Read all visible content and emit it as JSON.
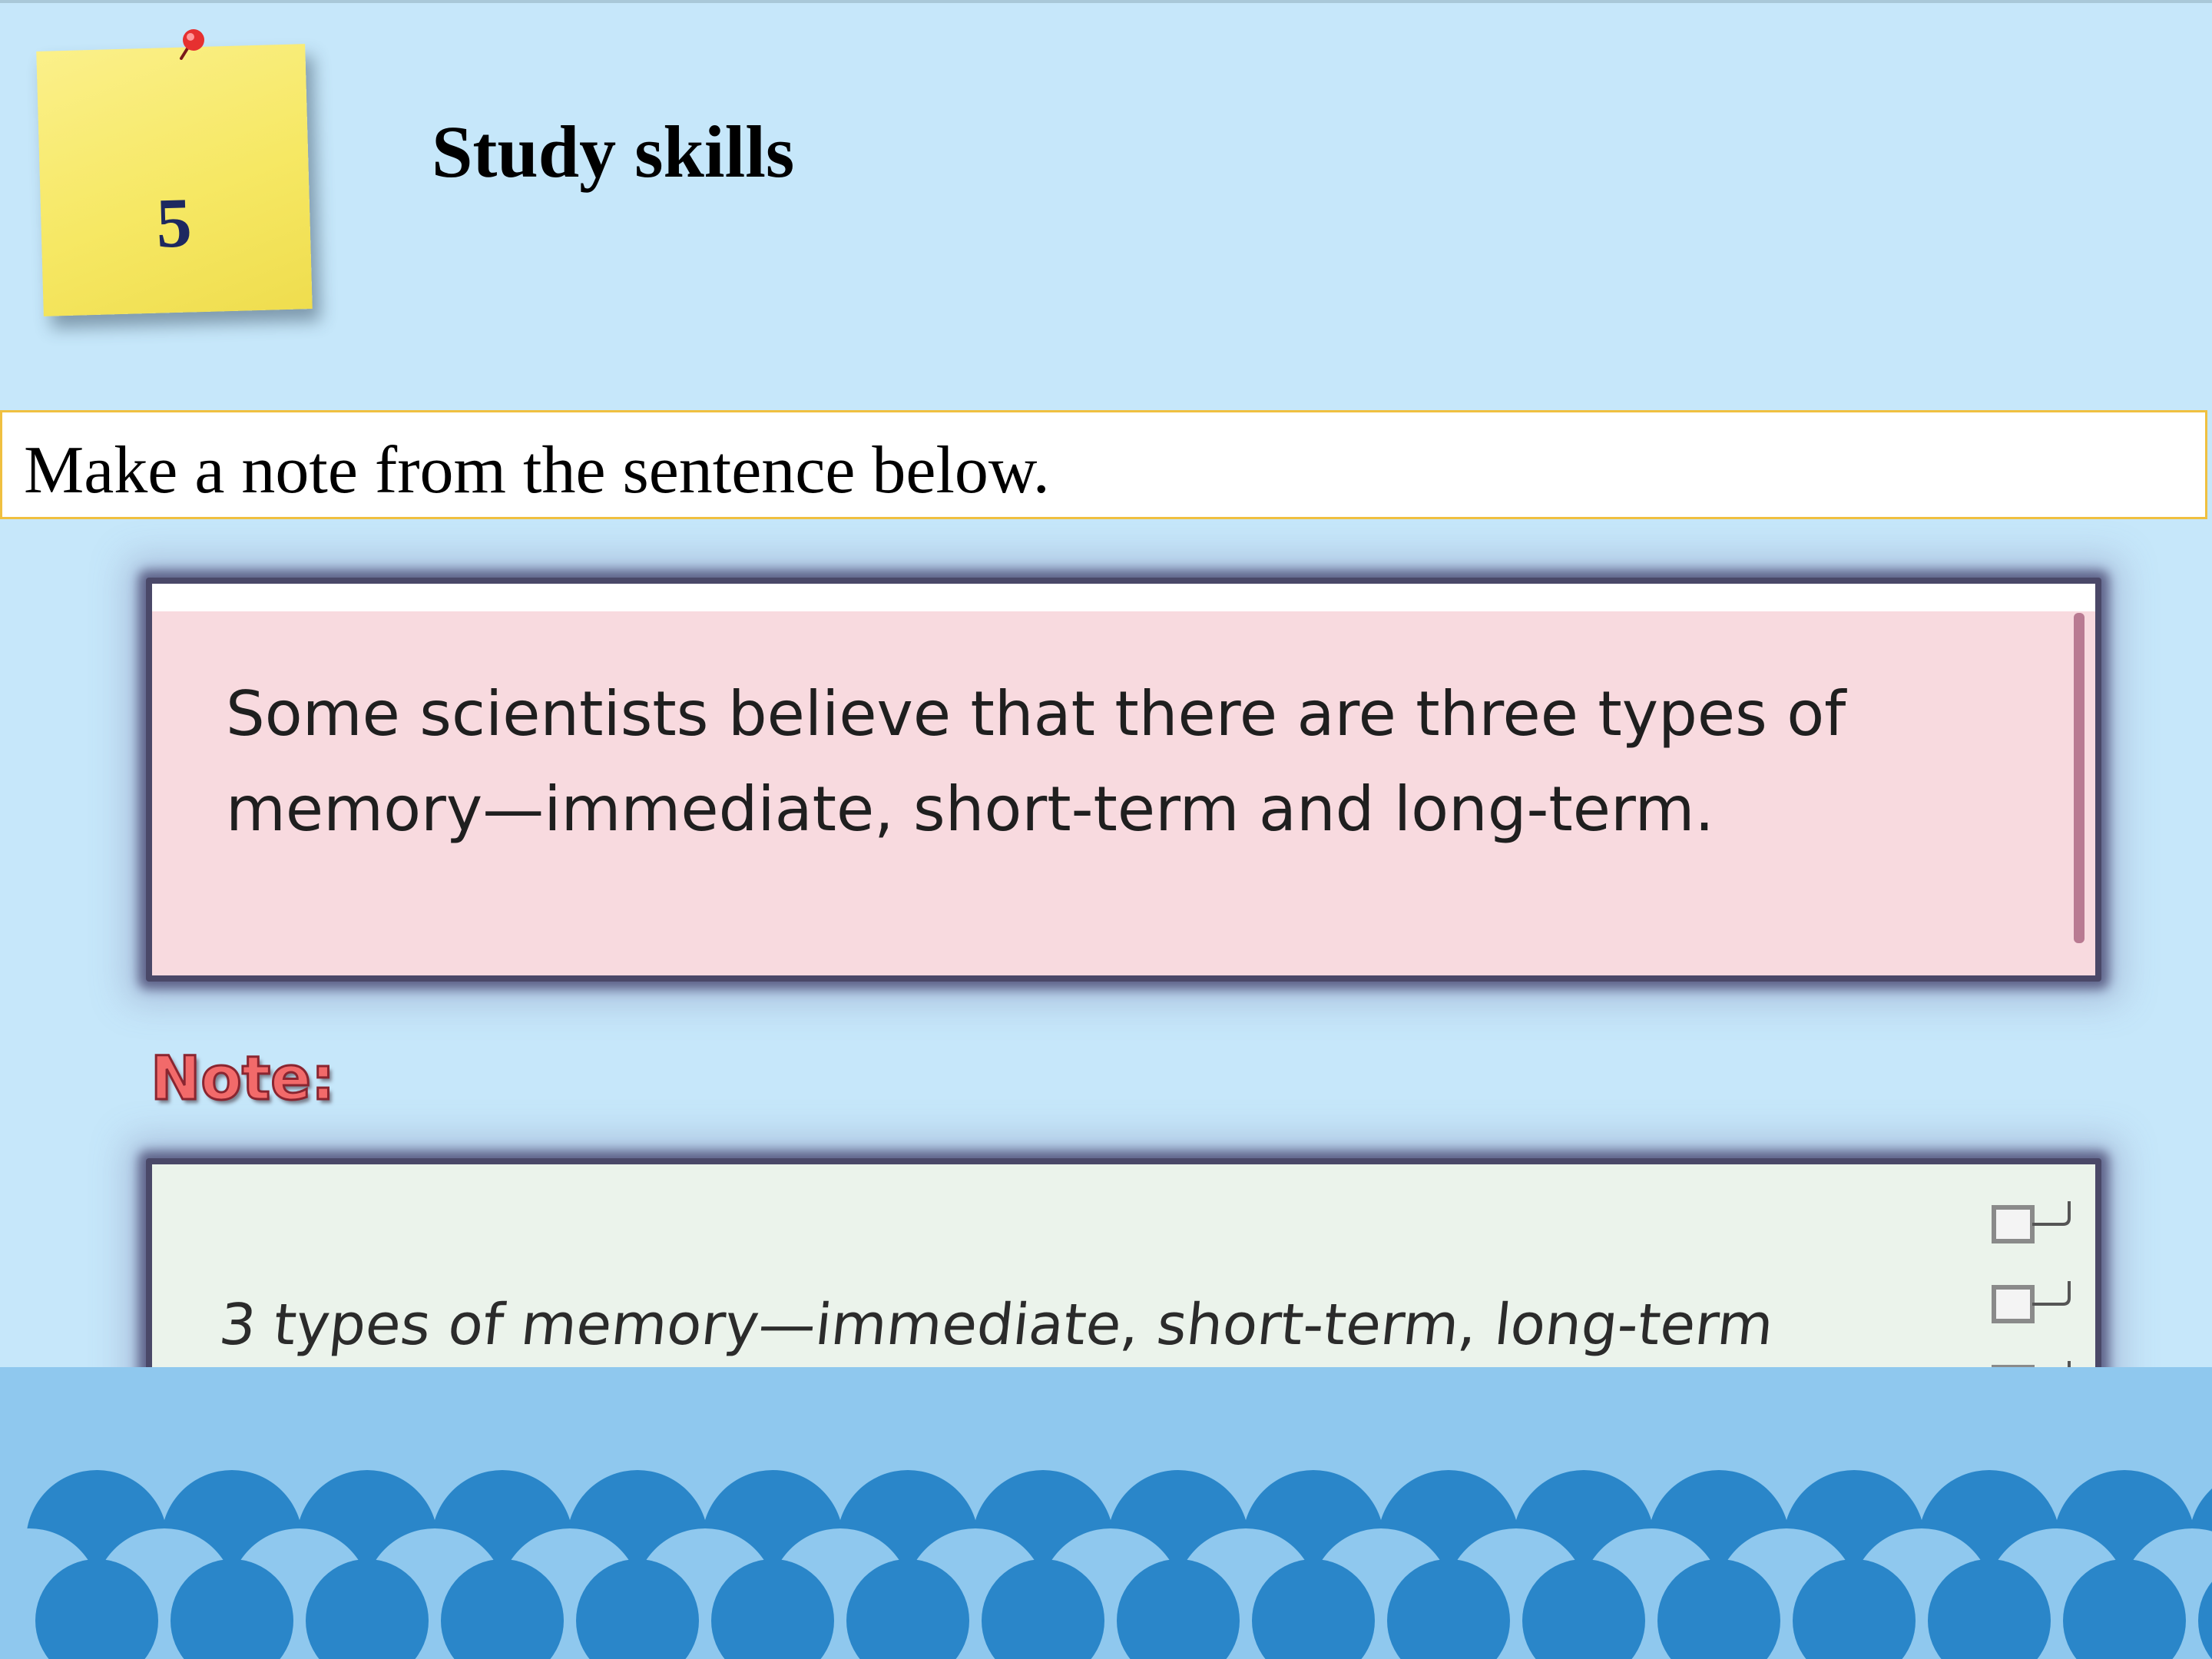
{
  "slide": {
    "number": "5",
    "title": "Study skills"
  },
  "instruction": "Make a note from the sentence below.",
  "sentence": {
    "line1": "Some scientists believe that there are three types of",
    "line2": "memory—immediate, short-term and long-term."
  },
  "note": {
    "label": "Note:",
    "text": "3 types of memory—immediate, short-term, long-term"
  },
  "colors": {
    "background": "#c6e7fa",
    "sticky_note": "#f6e864",
    "note_label": "#f26a6a",
    "sentence_card": "#f8dadf",
    "note_card": "#ebf3eb",
    "waves": "#2a86c9"
  },
  "icons": {
    "pin": "push-pin-icon",
    "binder": "binder-rings-icon"
  }
}
